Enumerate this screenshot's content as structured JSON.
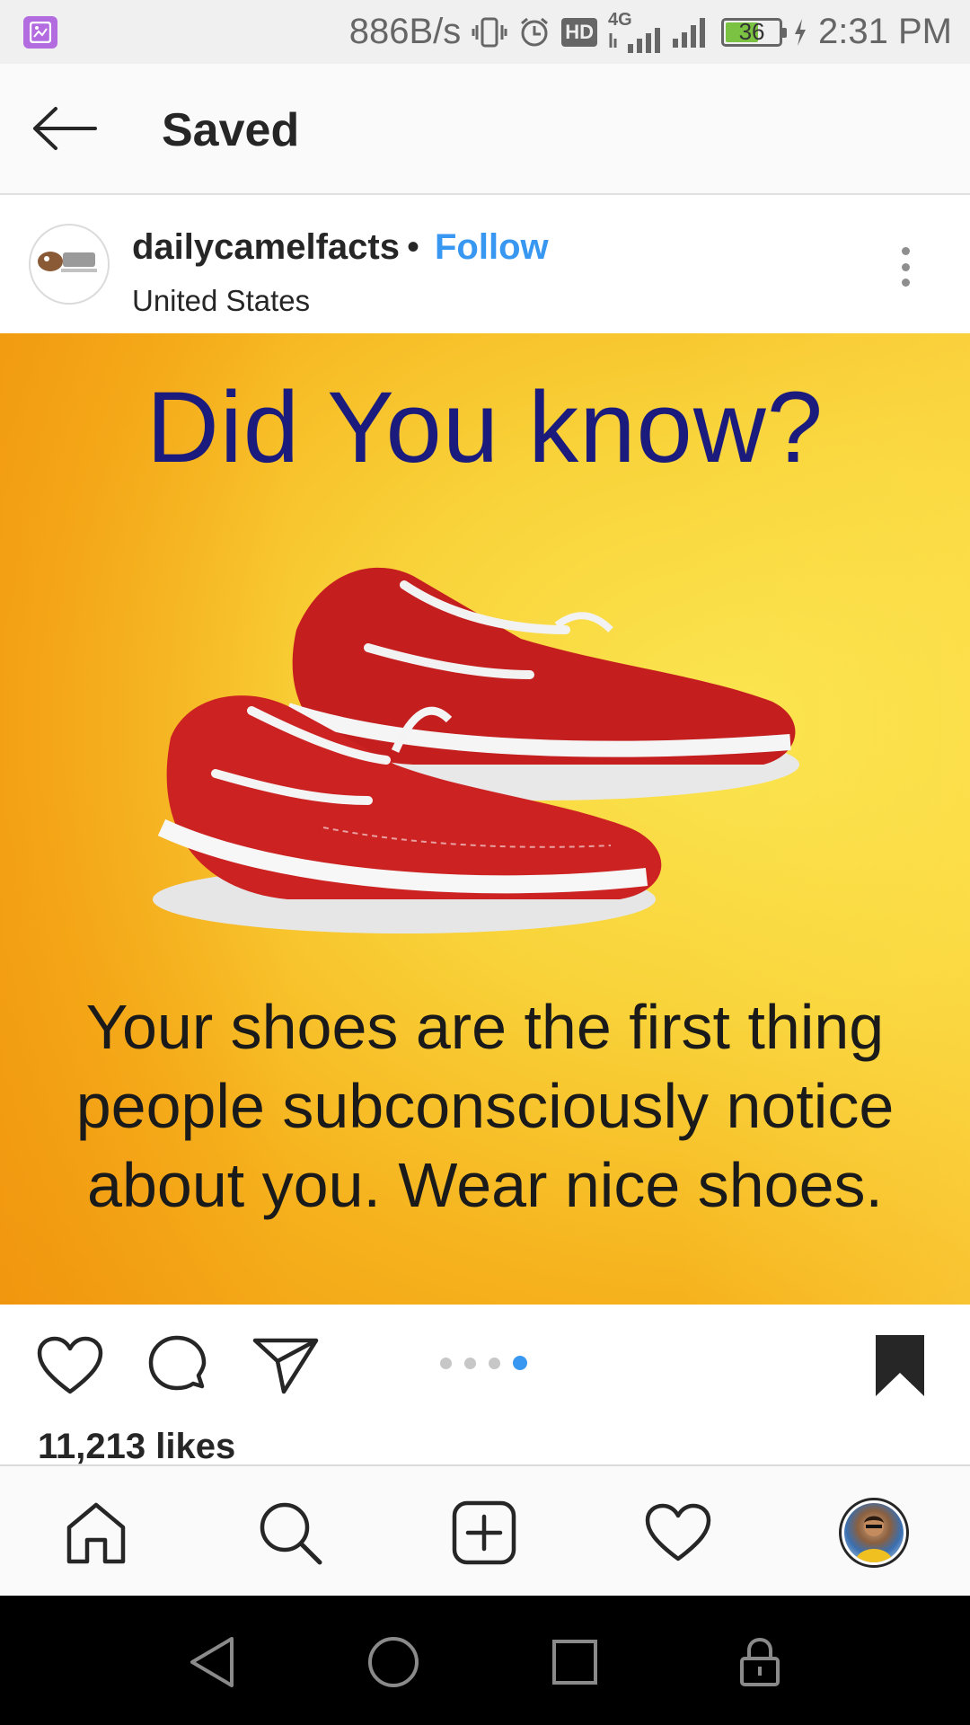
{
  "status_bar": {
    "net_speed": "886B/s",
    "network_type": "4G",
    "hd_badge": "HD",
    "battery_level": "36",
    "time": "2:31 PM",
    "icons": [
      "gallery-icon",
      "vibrate-icon",
      "alarm-icon",
      "signal-icon",
      "battery-charging-icon"
    ]
  },
  "header": {
    "title": "Saved",
    "back_icon": "arrow-left-icon"
  },
  "post": {
    "username": "dailycamelfacts",
    "separator": "•",
    "follow_label": "Follow",
    "location": "United States",
    "image": {
      "heading": "Did You know?",
      "caption": "Your shoes are the first thing people subconsciously notice about you. Wear nice shoes."
    },
    "carousel": {
      "count": 4,
      "active_index": 3
    },
    "likes": "11,213 likes"
  },
  "colors": {
    "accent": "#3897f0",
    "text": "#262626",
    "image_heading": "#1b1b7d",
    "image_bg": "#f9d33a"
  },
  "bottom_nav": {
    "items": [
      "home-icon",
      "search-icon",
      "add-post-icon",
      "activity-heart-icon",
      "profile-avatar"
    ]
  },
  "system_nav": {
    "items": [
      "back-triangle-icon",
      "home-circle-icon",
      "recents-square-icon",
      "lock-icon"
    ]
  }
}
